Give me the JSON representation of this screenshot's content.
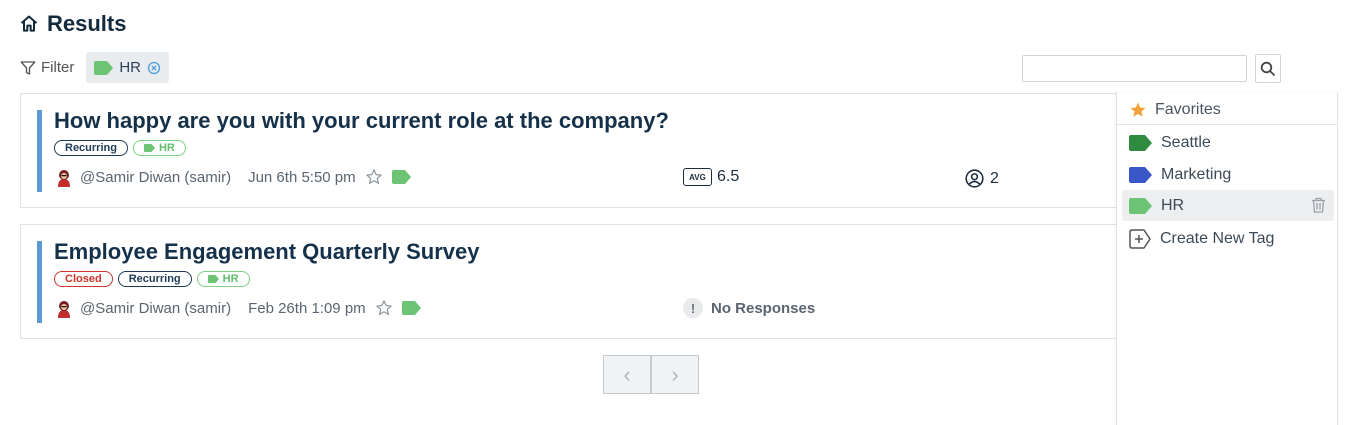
{
  "page": {
    "title": "Results"
  },
  "filter": {
    "label": "Filter",
    "active_chip": {
      "label": "HR",
      "color": "#6cc474"
    }
  },
  "search": {
    "value": "",
    "placeholder": ""
  },
  "colors": {
    "accent_bar": "#5b9bd5",
    "tag_green": "#6cc474",
    "tag_darkgreen": "#2e8b3f",
    "tag_blue": "#3b57c7"
  },
  "surveys": [
    {
      "title": "How happy are you with your current role at the company?",
      "badges": [
        "Recurring",
        "HR"
      ],
      "author": "@Samir Diwan (samir)",
      "date": "Jun 6th 5:50 pm",
      "avg_label": "AVG",
      "avg_value": "6.5",
      "responses": "2"
    },
    {
      "title": "Employee Engagement Quarterly Survey",
      "badges": [
        "Closed",
        "Recurring",
        "HR"
      ],
      "author": "@Samir Diwan (samir)",
      "date": "Feb 26th 1:09 pm",
      "status_icon": "!",
      "status_text": "No Responses"
    }
  ],
  "pager": {
    "prev": "‹",
    "next": "›"
  },
  "tag_menu": {
    "header": "Favorites",
    "items": [
      {
        "label": "Seattle",
        "color": "#2e8b3f"
      },
      {
        "label": "Marketing",
        "color": "#3b57c7"
      },
      {
        "label": "HR",
        "color": "#6cc474"
      }
    ],
    "create_label": "Create New Tag"
  }
}
